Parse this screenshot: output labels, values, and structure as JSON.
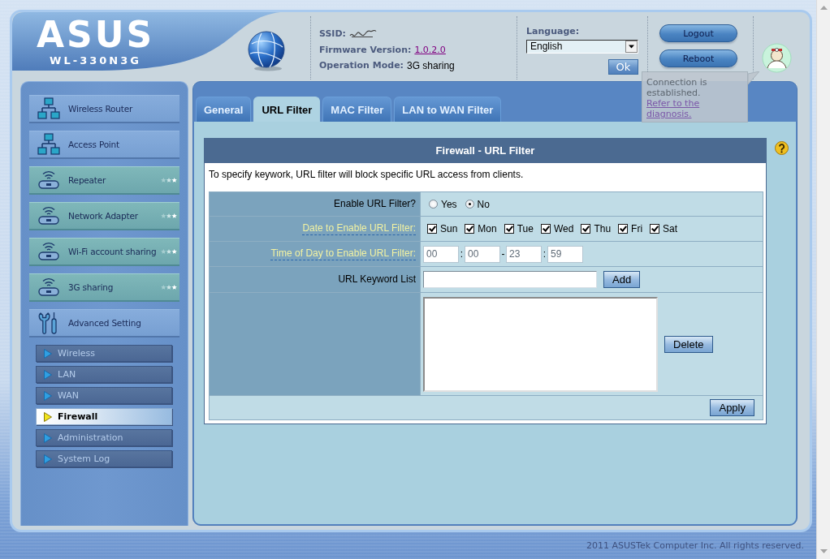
{
  "header": {
    "logo": "ASUS",
    "model": "WL-330N3G",
    "info": [
      {
        "label": "SSID:",
        "kind": "redacted"
      },
      {
        "label": "Firmware Version:",
        "value": "1.0.2.0",
        "kind": "link"
      },
      {
        "label": "Operation Mode:",
        "value": "3G sharing",
        "kind": "text"
      }
    ],
    "language": {
      "label": "Language:",
      "value": "English",
      "button": "Ok"
    },
    "buttons": [
      "Logout",
      "Reboot"
    ],
    "tooltip": {
      "message": "Connection is established.",
      "link": "Refer to the diagnosis."
    }
  },
  "sidebar": {
    "items": [
      {
        "label": "Wireless Router",
        "kind": "network"
      },
      {
        "label": "Access Point",
        "kind": "network"
      },
      {
        "label": "Repeater",
        "kind": "router"
      },
      {
        "label": "Network Adapter",
        "kind": "router"
      },
      {
        "label": "Wi-Fi account sharing",
        "kind": "router"
      },
      {
        "label": "3G sharing",
        "kind": "router"
      },
      {
        "label": "Advanced Setting",
        "kind": "tools"
      }
    ],
    "subitems": [
      {
        "label": "Wireless",
        "selected": false
      },
      {
        "label": "LAN",
        "selected": false
      },
      {
        "label": "WAN",
        "selected": false
      },
      {
        "label": "Firewall",
        "selected": true
      },
      {
        "label": "Administration",
        "selected": false
      },
      {
        "label": "System Log",
        "selected": false
      }
    ]
  },
  "tabs": [
    {
      "label": "General",
      "selected": false
    },
    {
      "label": "URL Filter",
      "selected": true
    },
    {
      "label": "MAC Filter",
      "selected": false
    },
    {
      "label": "LAN to WAN Filter",
      "selected": false
    }
  ],
  "panel": {
    "title": "Firewall - URL Filter",
    "description": "To specify keywork, URL filter will block specific URL access from clients.",
    "rows": [
      {
        "kind": "radio",
        "label": "Enable URL Filter?",
        "hint": false,
        "options": [
          {
            "label": "Yes",
            "selected": false
          },
          {
            "label": "No",
            "selected": true
          }
        ]
      },
      {
        "kind": "days",
        "label": "Date to Enable URL Filter:",
        "hint": true,
        "options": [
          {
            "label": "Sun",
            "checked": true
          },
          {
            "label": "Mon",
            "checked": true
          },
          {
            "label": "Tue",
            "checked": true
          },
          {
            "label": "Wed",
            "checked": true
          },
          {
            "label": "Thu",
            "checked": true
          },
          {
            "label": "Fri",
            "checked": true
          },
          {
            "label": "Sat",
            "checked": true
          }
        ]
      },
      {
        "kind": "time",
        "label": "Time of Day to Enable URL Filter:",
        "hint": true,
        "fields": [
          "00",
          "00",
          "23",
          "59"
        ],
        "separators": [
          ":",
          "-",
          ":"
        ]
      },
      {
        "kind": "keyword",
        "label": "URL Keyword List",
        "hint": false,
        "button": "Add"
      },
      {
        "kind": "list",
        "button": "Delete"
      }
    ],
    "apply": "Apply"
  },
  "footer": "2011 ASUSTek Computer Inc. All rights reserved."
}
